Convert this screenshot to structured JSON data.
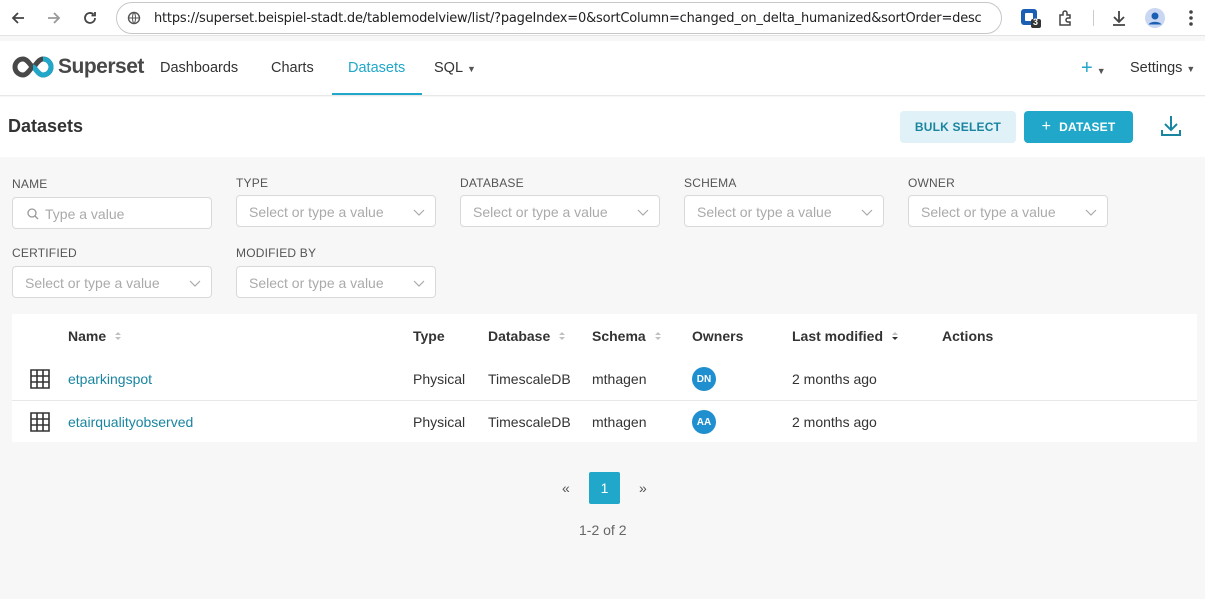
{
  "browser": {
    "url": "https://superset.beispiel-stadt.de/tablemodelview/list/?pageIndex=0&sortColumn=changed_on_delta_humanized&sortOrder=desc",
    "extension_badge": "3"
  },
  "app": {
    "logo_text": "Superset",
    "nav": {
      "dashboards": "Dashboards",
      "charts": "Charts",
      "datasets": "Datasets",
      "sql": "SQL",
      "add": "+",
      "settings": "Settings"
    }
  },
  "page": {
    "title": "Datasets",
    "bulk_select_label": "BULK SELECT",
    "add_dataset_label": "DATASET",
    "add_dataset_icon": "+"
  },
  "filters": {
    "name": {
      "label": "NAME",
      "placeholder": "Type a value"
    },
    "type": {
      "label": "TYPE",
      "placeholder": "Select or type a value"
    },
    "database": {
      "label": "DATABASE",
      "placeholder": "Select or type a value"
    },
    "schema": {
      "label": "SCHEMA",
      "placeholder": "Select or type a value"
    },
    "owner": {
      "label": "OWNER",
      "placeholder": "Select or type a value"
    },
    "certified": {
      "label": "CERTIFIED",
      "placeholder": "Select or type a value"
    },
    "modified_by": {
      "label": "MODIFIED BY",
      "placeholder": "Select or type a value"
    }
  },
  "table": {
    "headers": {
      "name": "Name",
      "type": "Type",
      "database": "Database",
      "schema": "Schema",
      "owners": "Owners",
      "last_modified": "Last modified",
      "actions": "Actions"
    },
    "rows": [
      {
        "name": "etparkingspot",
        "type": "Physical",
        "database": "TimescaleDB",
        "schema": "mthagen",
        "owner_initials": "DN",
        "last_modified": "2 months ago"
      },
      {
        "name": "etairqualityobserved",
        "type": "Physical",
        "database": "TimescaleDB",
        "schema": "mthagen",
        "owner_initials": "AA",
        "last_modified": "2 months ago"
      }
    ]
  },
  "pagination": {
    "prev": "«",
    "current": "1",
    "next": "»",
    "count": "1-2 of 2"
  },
  "colors": {
    "accent": "#20a7c9",
    "link": "#1a85a0",
    "avatar": "#1f8fd0"
  }
}
